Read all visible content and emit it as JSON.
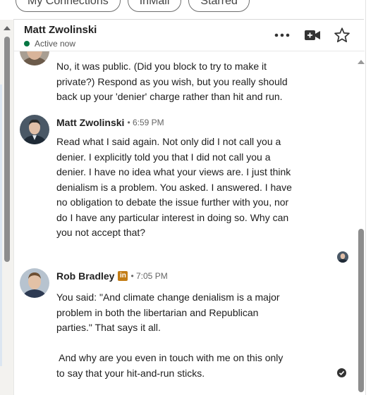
{
  "filters": {
    "pills": [
      "My Connections",
      "InMail",
      "Starred"
    ]
  },
  "header": {
    "name": "Matt Zwolinski",
    "status": "Active now",
    "more_icon": "more-horizontal-icon",
    "video_icon": "video-call-icon",
    "star_icon": "star-icon"
  },
  "messages": [
    {
      "sender": "",
      "time": "",
      "lines": [
        "No, it was public. (Did you block to try to make it",
        "private?) Respond as you wish, but you really should",
        "back up your 'denier' charge rather than hit and run."
      ]
    },
    {
      "sender": "Matt Zwolinski",
      "time": "• 6:59 PM",
      "lines": [
        "Read what I said again. Not only did I not call you a",
        "denier. I explicitly told you that I did not call you a",
        "denier. I have no idea what your views are. I just think",
        "denialism is a problem. You asked. I answered. I have",
        "no obligation to debate the issue further with you, nor",
        "do I have any particular interest in doing so. Why can",
        "you not accept that?"
      ]
    },
    {
      "sender": "Rob Bradley",
      "badge": "in",
      "time": "• 7:05 PM",
      "lines": [
        "You said: \"And climate change denialism is a major",
        "problem in both the libertarian and Republican",
        "parties.\"  That says it all.",
        "",
        " And why are you even in touch with me on this only",
        "to say that your hit-and-run sticks."
      ]
    }
  ],
  "colors": {
    "active": "#057642",
    "linkedin_badge": "#c37d16"
  }
}
